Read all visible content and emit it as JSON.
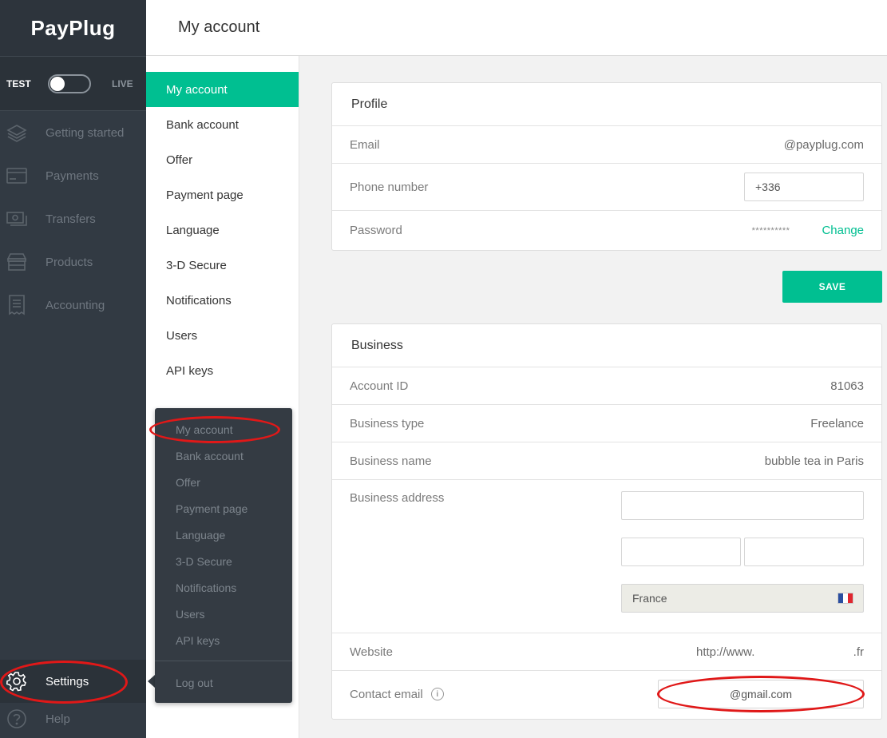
{
  "brand": {
    "name": "PayPlug"
  },
  "mode": {
    "test_label": "TEST",
    "live_label": "LIVE"
  },
  "sidebar": {
    "items": [
      {
        "label": "Getting started",
        "icon": "layers-icon"
      },
      {
        "label": "Payments",
        "icon": "card-icon"
      },
      {
        "label": "Transfers",
        "icon": "money-icon"
      },
      {
        "label": "Products",
        "icon": "store-icon"
      },
      {
        "label": "Accounting",
        "icon": "receipt-icon"
      }
    ],
    "settings_label": "Settings",
    "help_label": "Help"
  },
  "header": {
    "title": "My account"
  },
  "submenu": {
    "items": [
      "My account",
      "Bank account",
      "Offer",
      "Payment page",
      "Language",
      "3-D Secure",
      "Notifications",
      "Users",
      "API keys"
    ],
    "active": "My account"
  },
  "popover": {
    "items": [
      "My account",
      "Bank account",
      "Offer",
      "Payment page",
      "Language",
      "3-D Secure",
      "Notifications",
      "Users",
      "API keys"
    ],
    "logout": "Log out"
  },
  "profile": {
    "title": "Profile",
    "email_label": "Email",
    "email_value": "@payplug.com",
    "phone_label": "Phone number",
    "phone_value": "+336",
    "password_label": "Password",
    "password_value": "**********",
    "change_label": "Change"
  },
  "save_label": "SAVE",
  "business": {
    "title": "Business",
    "account_id_label": "Account ID",
    "account_id_value": "81063",
    "type_label": "Business type",
    "type_value": "Freelance",
    "name_label": "Business name",
    "name_value": "bubble tea in Paris",
    "address_label": "Business address",
    "country_value": "France",
    "website_label": "Website",
    "website_prefix": "http://www.",
    "website_suffix": ".fr",
    "contact_label": "Contact email",
    "contact_value": "@gmail.com"
  },
  "colors": {
    "accent": "#00bf91",
    "sidebar": "#323a43",
    "annotation": "#e01818"
  }
}
